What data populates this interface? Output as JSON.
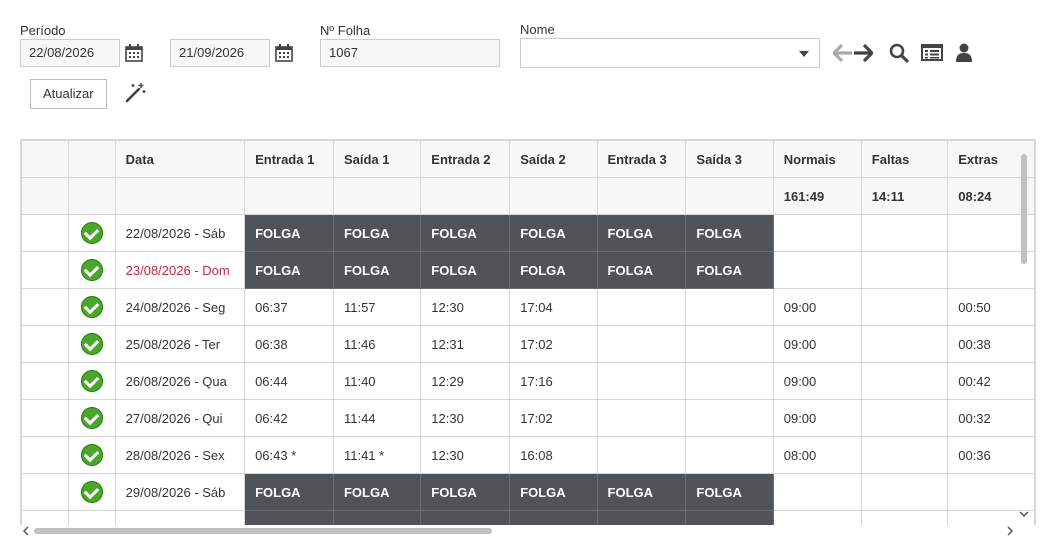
{
  "filters": {
    "periodo_label": "Período",
    "date_start": "22/08/2026",
    "date_end": "21/09/2026",
    "folha_label": "Nº Folha",
    "folha_value": "1067",
    "nome_label": "Nome",
    "nome_value": ""
  },
  "toolbar": {
    "atualizar": "Atualizar"
  },
  "table": {
    "columns": [
      "",
      "",
      "Data",
      "Entrada 1",
      "Saída 1",
      "Entrada 2",
      "Saída 2",
      "Entrada 3",
      "Saída 3",
      "Normais",
      "Faltas",
      "Extras"
    ],
    "totals": {
      "normais": "161:49",
      "faltas": "14:11",
      "extras": "08:24"
    },
    "rows": [
      {
        "date": "22/08/2026 - Sáb",
        "folga": true,
        "label": "FOLGA"
      },
      {
        "date": "23/08/2026 - Dom",
        "folga": true,
        "label": "FOLGA",
        "sunday": true
      },
      {
        "date": "24/08/2026 - Seg",
        "e1": "06:37",
        "s1": "11:57",
        "e2": "12:30",
        "s2": "17:04",
        "normais": "09:00",
        "extras": "00:50"
      },
      {
        "date": "25/08/2026 - Ter",
        "e1": "06:38",
        "s1": "11:46",
        "e2": "12:31",
        "s2": "17:02",
        "normais": "09:00",
        "extras": "00:38"
      },
      {
        "date": "26/08/2026 - Qua",
        "e1": "06:44",
        "s1": "11:40",
        "e2": "12:29",
        "s2": "17:16",
        "normais": "09:00",
        "extras": "00:42"
      },
      {
        "date": "27/08/2026 - Qui",
        "e1": "06:42",
        "s1": "11:44",
        "e2": "12:30",
        "s2": "17:02",
        "normais": "09:00",
        "extras": "00:32"
      },
      {
        "date": "28/08/2026 - Sex",
        "e1": "06:43 *",
        "s1": "11:41 *",
        "e2": "12:30",
        "s2": "16:08",
        "normais": "08:00",
        "extras": "00:36"
      },
      {
        "date": "29/08/2026 - Sáb",
        "folga": true,
        "label": "FOLGA"
      },
      {
        "date": "",
        "folga": true,
        "label": ""
      }
    ]
  }
}
